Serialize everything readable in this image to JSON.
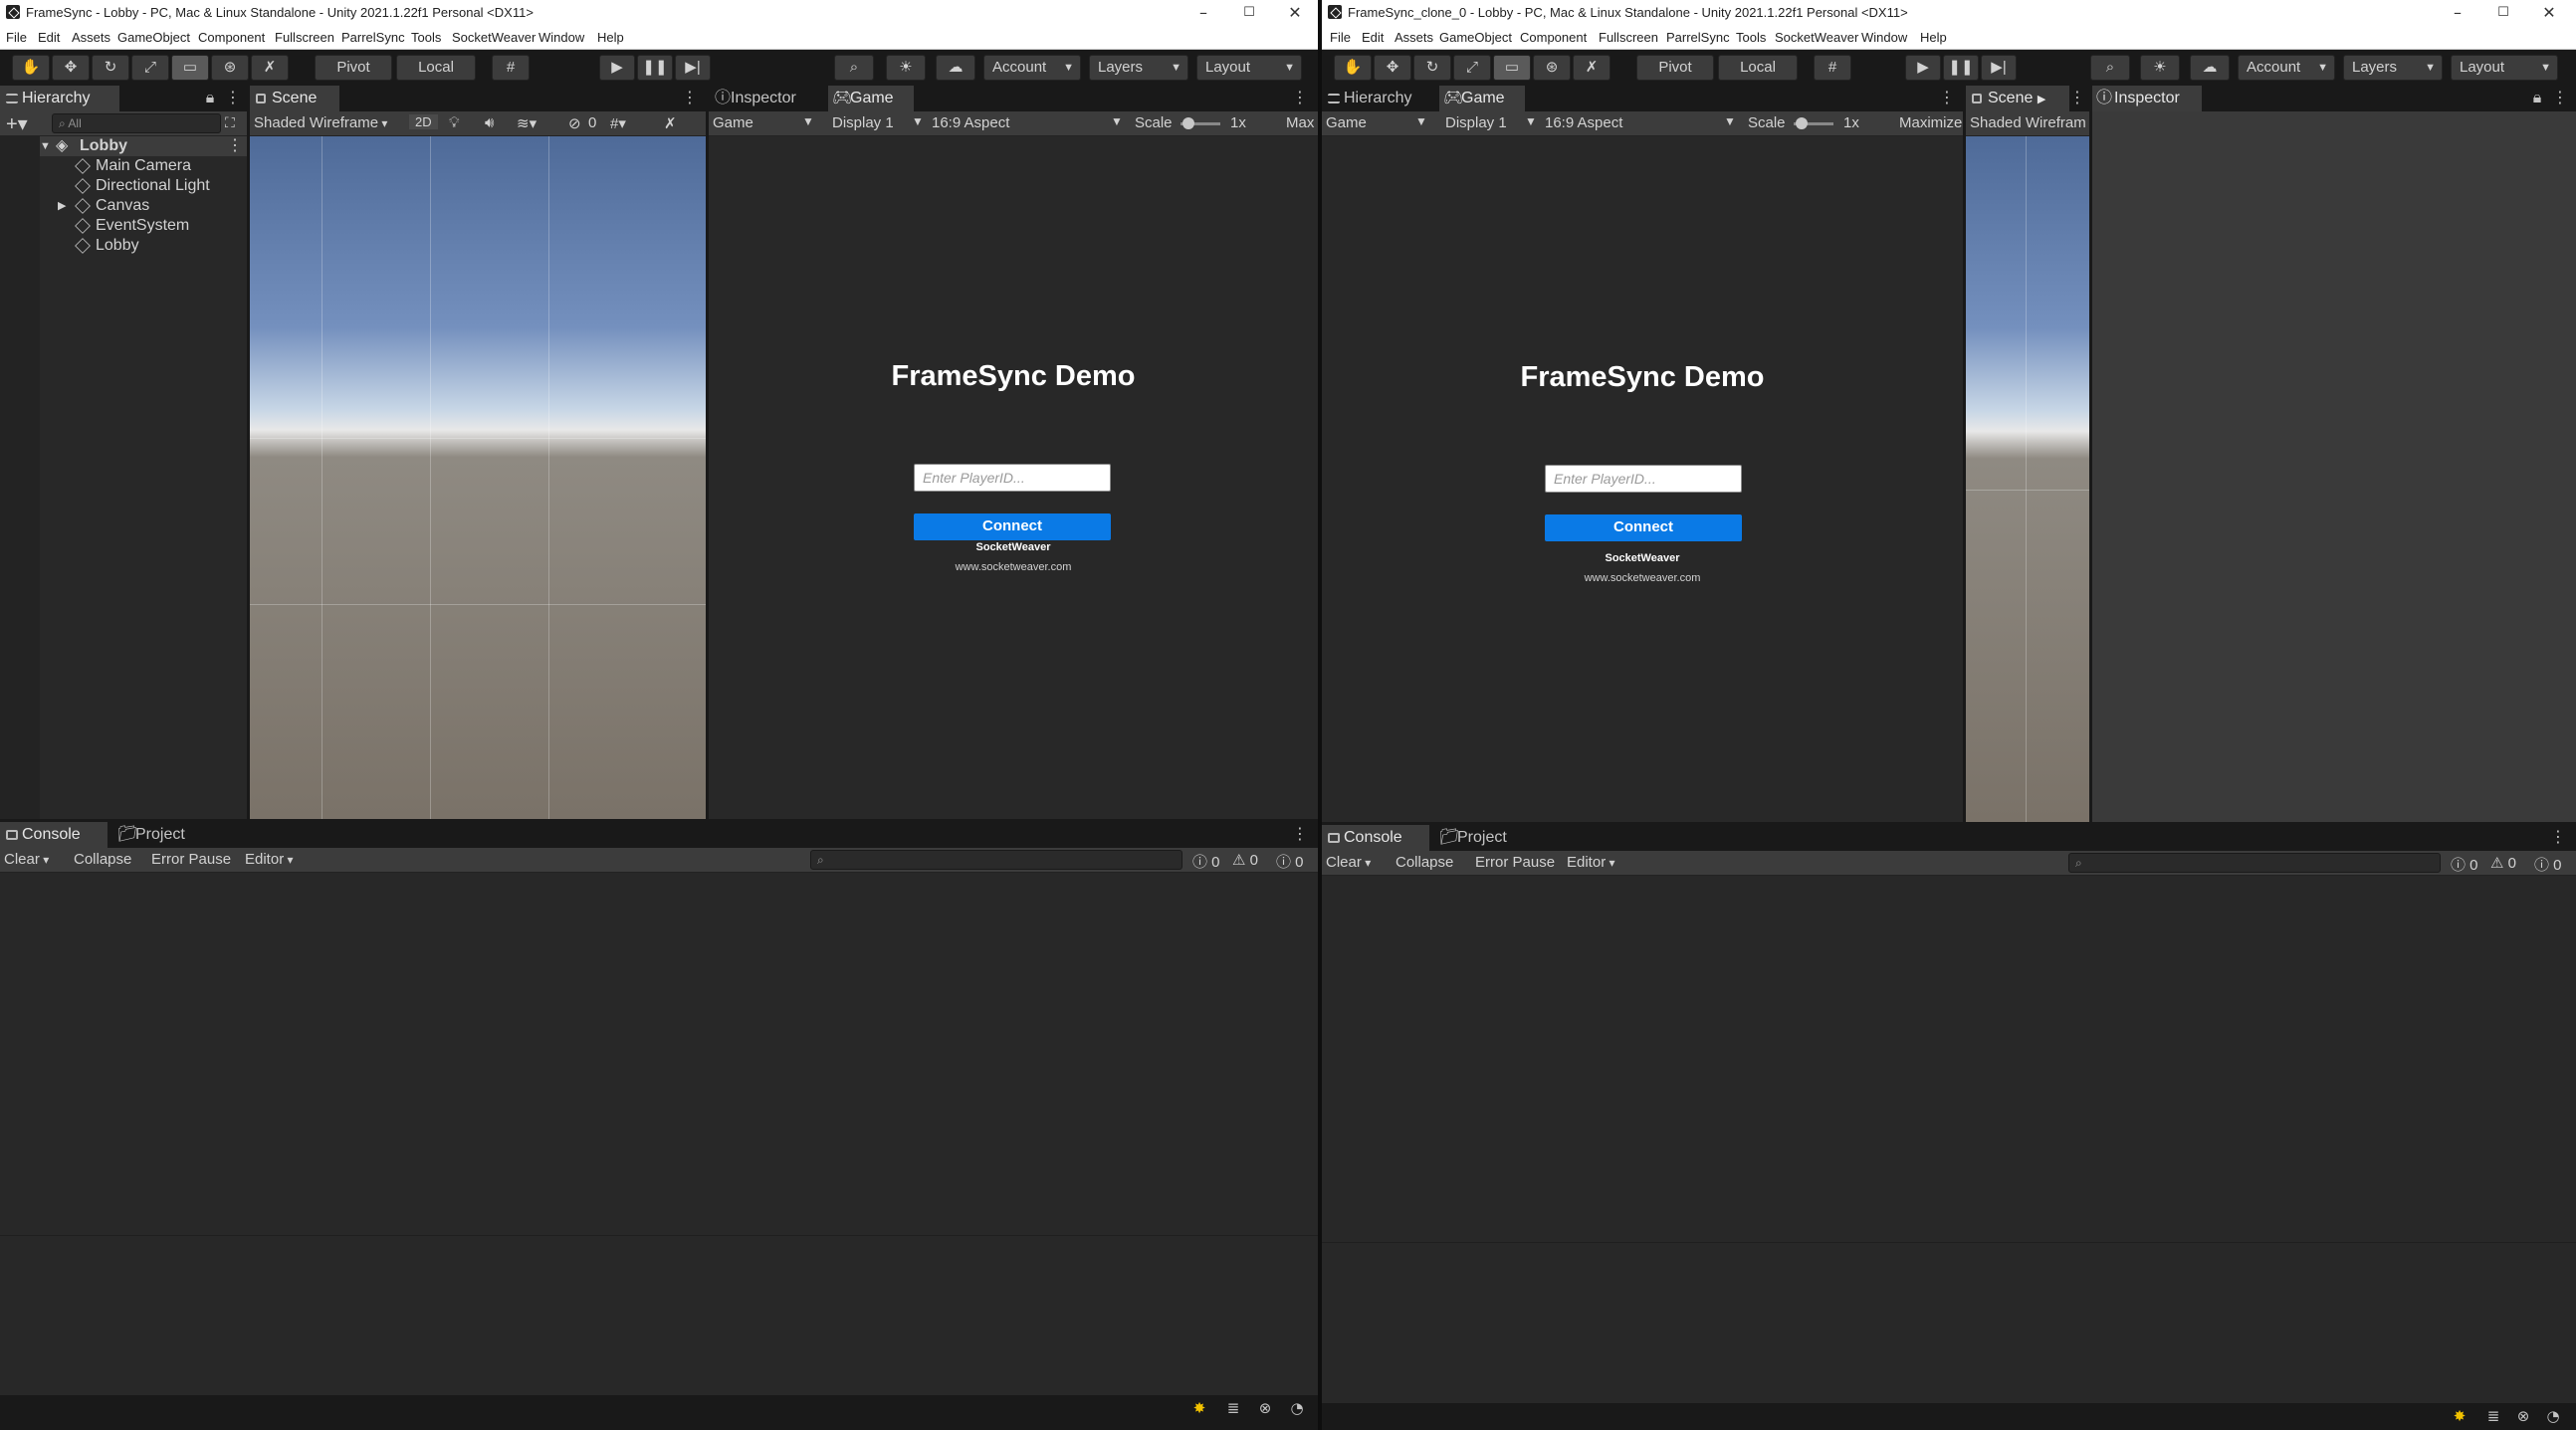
{
  "left_window": {
    "title": "FrameSync - Lobby - PC, Mac & Linux Standalone - Unity 2021.1.22f1 Personal <DX11>",
    "menu": [
      "File",
      "Edit",
      "Assets",
      "GameObject",
      "Component",
      "Fullscreen",
      "ParrelSync",
      "Tools",
      "SocketWeaver",
      "Window",
      "Help"
    ],
    "toolbar": {
      "pivot": "Pivot",
      "local": "Local",
      "account": "Account",
      "layers": "Layers",
      "layout": "Layout"
    },
    "hierarchy": {
      "tab": "Hierarchy",
      "search_placeholder": "All",
      "scene": "Lobby",
      "items": [
        "Main Camera",
        "Directional Light",
        "Canvas",
        "EventSystem",
        "Lobby"
      ]
    },
    "scene": {
      "tab": "Scene",
      "shading": "Shaded Wireframe",
      "mode_2d": "2D",
      "hidden_count": "0"
    },
    "game": {
      "tab_inspector": "Inspector",
      "tab_game": "Game",
      "display_mode": "Game",
      "display": "Display 1",
      "aspect": "16:9 Aspect",
      "scale_label": "Scale",
      "scale_value": "1x",
      "maximize": "Max"
    },
    "console": {
      "tab_console": "Console",
      "tab_project": "Project",
      "clear": "Clear",
      "collapse": "Collapse",
      "error_pause": "Error Pause",
      "editor": "Editor",
      "log_count": "0",
      "warn_count": "0",
      "error_count": "0"
    }
  },
  "right_window": {
    "title": "FrameSync_clone_0 - Lobby - PC, Mac & Linux Standalone - Unity 2021.1.22f1 Personal <DX11>",
    "menu": [
      "File",
      "Edit",
      "Assets",
      "GameObject",
      "Component",
      "Fullscreen",
      "ParrelSync",
      "Tools",
      "SocketWeaver",
      "Window",
      "Help"
    ],
    "toolbar": {
      "pivot": "Pivot",
      "local": "Local",
      "account": "Account",
      "layers": "Layers",
      "layout": "Layout"
    },
    "hierarchy_tab": "Hierarchy",
    "game": {
      "tab_game": "Game",
      "display_mode": "Game",
      "display": "Display 1",
      "aspect": "16:9 Aspect",
      "scale_label": "Scale",
      "scale_value": "1x",
      "maximize": "Maximize"
    },
    "scene": {
      "tab": "Scene",
      "shading": "Shaded Wirefram"
    },
    "inspector_tab": "Inspector",
    "console": {
      "tab_console": "Console",
      "tab_project": "Project",
      "clear": "Clear",
      "collapse": "Collapse",
      "error_pause": "Error Pause",
      "editor": "Editor",
      "log_count": "0",
      "warn_count": "0",
      "error_count": "0"
    }
  },
  "game_ui": {
    "title": "FrameSync Demo",
    "player_placeholder": "Enter PlayerID...",
    "connect": "Connect",
    "brand": "SocketWeaver",
    "url": "www.socketweaver.com"
  },
  "colors": {
    "connect_button": "#0a7ae6",
    "editor_background": "#282828",
    "toolbar": "#191919"
  }
}
